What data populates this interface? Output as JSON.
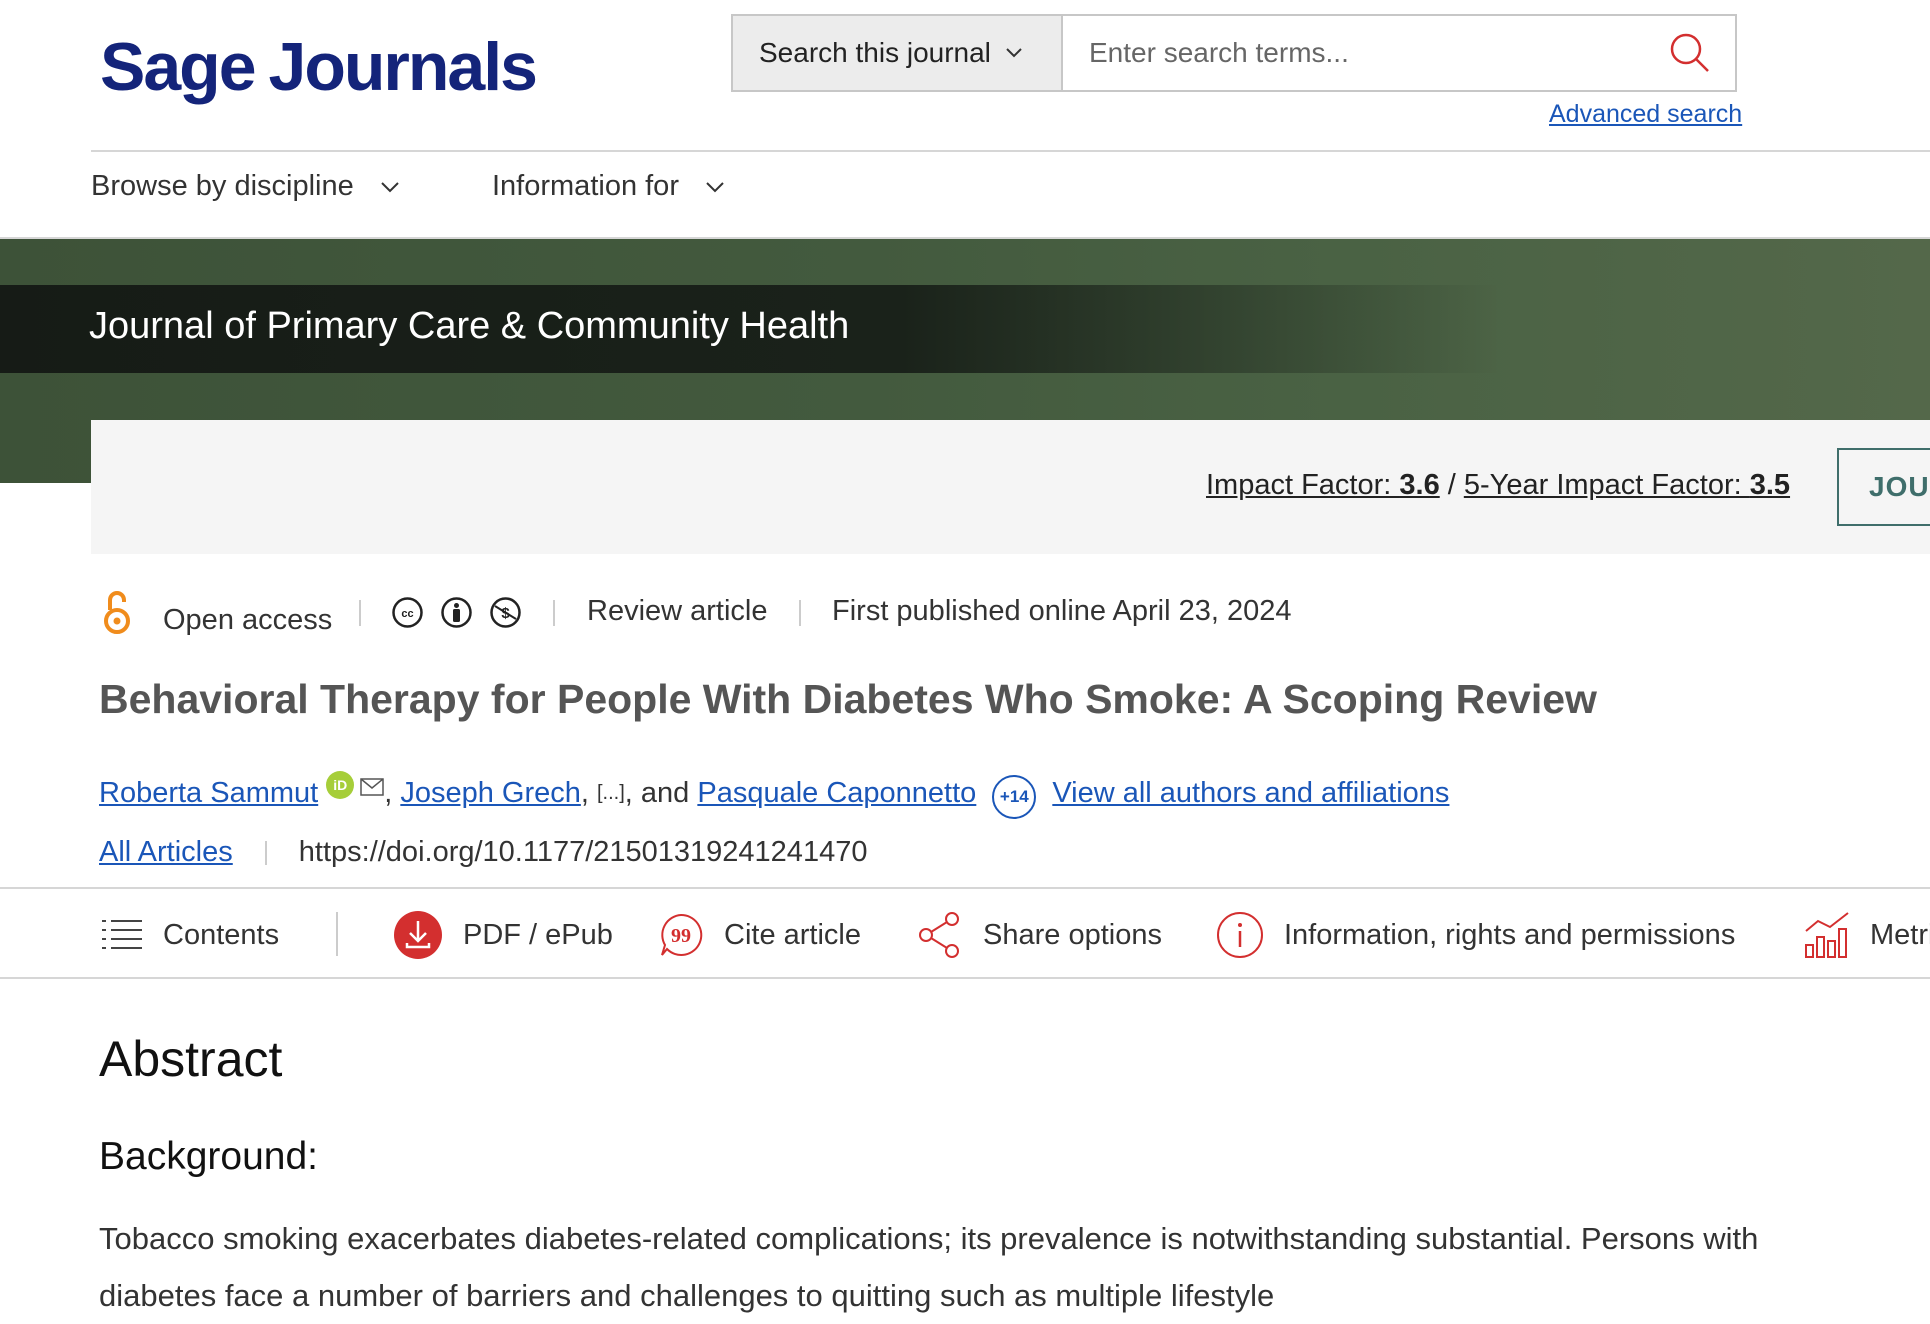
{
  "header": {
    "logo_sage": "Sage",
    "logo_journals": "Journals",
    "search_scope": "Search this journal",
    "search_placeholder": "Enter search terms...",
    "advanced_search": "Advanced search"
  },
  "nav": {
    "browse": "Browse by discipline",
    "info_for": "Information for"
  },
  "banner": {
    "journal_title": "Journal of Primary Care & Community Health",
    "impact_label": "Impact Factor: ",
    "impact_value": "3.6",
    "slash": " / ",
    "five_year_label": "5-Year Impact Factor: ",
    "five_year_value": "3.5",
    "journal_button": "JOUR"
  },
  "article": {
    "access": "Open access",
    "type": "Review article",
    "published": "First published online April 23, 2024",
    "title": "Behavioral Therapy for People With Diabetes Who Smoke: A Scoping Review",
    "author1": "Roberta Sammut",
    "author2": "Joseph Grech",
    "ellipsis": "[...]",
    "and": ", and ",
    "author3": "Pasquale Caponnetto",
    "more_count": "+14",
    "view_all": "View all authors and affiliations",
    "all_articles": "All Articles",
    "doi": "https://doi.org/10.1177/21501319241241470"
  },
  "toolbar": {
    "contents": "Contents",
    "pdf": "PDF / ePub",
    "cite": "Cite article",
    "share": "Share options",
    "info": "Information, rights and permissions",
    "metrics": "Metrics"
  },
  "abstract": {
    "heading": "Abstract",
    "background_heading": "Background:",
    "background_text": "Tobacco smoking exacerbates diabetes-related complications; its prevalence is notwithstanding substantial. Persons with diabetes face a number of barriers and challenges to quitting such as multiple lifestyle"
  },
  "colors": {
    "brand": "#14247a",
    "link": "#1a56b8",
    "accent_red": "#d32f2f",
    "open_access": "#f08c1c",
    "banner_green": "#435a3e"
  }
}
